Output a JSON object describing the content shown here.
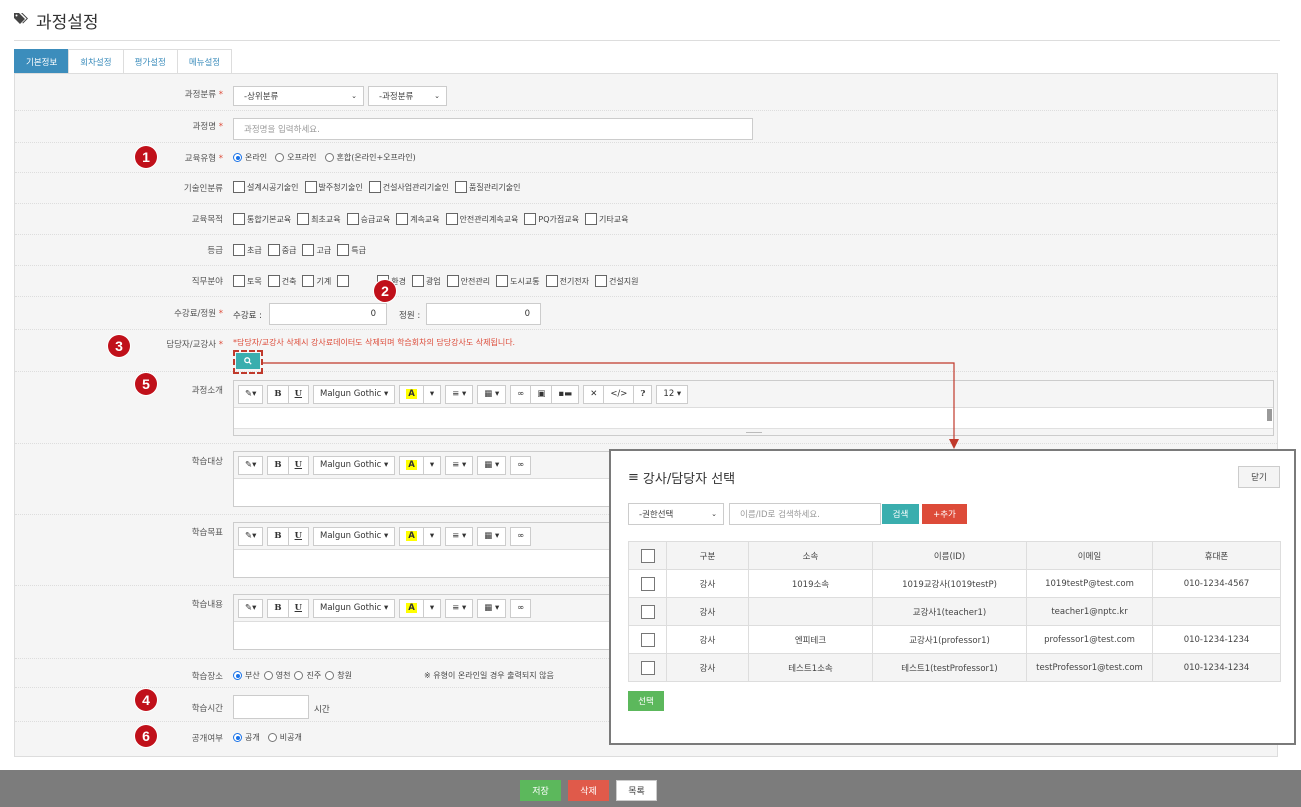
{
  "page": {
    "title": "과정설정"
  },
  "tabs": [
    {
      "label": "기본정보",
      "active": true
    },
    {
      "label": "회차설정",
      "active": false
    },
    {
      "label": "평가설정",
      "active": false
    },
    {
      "label": "메뉴설정",
      "active": false
    }
  ],
  "form": {
    "category": {
      "label": "과정분류",
      "required": "*",
      "upper_select": "-상위분류",
      "course_select": "-과정분류"
    },
    "course_name": {
      "label": "과정명",
      "required": "*",
      "placeholder": "과정명을 입력하세요."
    },
    "edu_type": {
      "label": "교육유형",
      "required": "*",
      "options": [
        "온라인",
        "오프라인",
        "혼합(온라인+오프라인)"
      ],
      "selected": "온라인"
    },
    "tech_class": {
      "label": "기술인분류",
      "options": [
        "설계시공기술인",
        "발주청기술인",
        "건설사업관리기술인",
        "품질관리기술인"
      ]
    },
    "edu_purpose": {
      "label": "교육목적",
      "options": [
        "통합기본교육",
        "최초교육",
        "승급교육",
        "계속교육",
        "안전관리계속교육",
        "PQ가점교육",
        "기타교육"
      ]
    },
    "grade": {
      "label": "등급",
      "options": [
        "초급",
        "중급",
        "고급",
        "특급"
      ]
    },
    "job_field": {
      "label": "직무분야",
      "options": [
        "토목",
        "건축",
        "기계",
        "",
        "환경",
        "광업",
        "안전관리",
        "도시교통",
        "전기전자",
        "건설지원"
      ]
    },
    "capacity": {
      "label": "수강료/정원",
      "required": "*",
      "fee_label": "수강료 :",
      "fee_value": "0",
      "cap_label": "정원 :",
      "cap_value": "0"
    },
    "instructor": {
      "label": "담당자/교강사",
      "required": "*",
      "warning": "*담당자/교강사 삭제시 강사료데이터도 삭제되며 학습회차의 담당강사도 삭제됩니다."
    },
    "intro": {
      "label": "과정소개"
    },
    "target": {
      "label": "학습대상"
    },
    "goal": {
      "label": "학습목표"
    },
    "content": {
      "label": "학습내용"
    },
    "place": {
      "label": "학습장소",
      "options": [
        "부산",
        "영천",
        "진주",
        "창원"
      ],
      "selected": "부산",
      "note": "※ 유형이 온라인일 경우 출력되지 않음"
    },
    "hours": {
      "label": "학습시간",
      "unit": "시간"
    },
    "public": {
      "label": "공개여부",
      "options": [
        "공개",
        "비공개"
      ],
      "selected": "공개"
    }
  },
  "editor_toolbar": {
    "font": "Malgun Gothic",
    "bold": "B",
    "underline": "U",
    "size": "12",
    "highlight": "A",
    "help": "?",
    "code": "</>"
  },
  "badges": [
    "1",
    "2",
    "3",
    "4",
    "5",
    "6"
  ],
  "bottom": {
    "save": "저장",
    "delete": "삭제",
    "list": "목록"
  },
  "modal": {
    "title": "강사/담당자 선택",
    "close": "닫기",
    "role_select": "-권한선택",
    "search_placeholder": "이름/ID로 검색하세요.",
    "search_btn": "검색",
    "add_btn": "+추가",
    "columns": [
      "구분",
      "소속",
      "이름(ID)",
      "이메일",
      "휴대폰"
    ],
    "rows": [
      [
        "강사",
        "1019소속",
        "1019교강사(1019testP)",
        "1019testP@test.com",
        "010-1234-4567"
      ],
      [
        "강사",
        "",
        "교강사1(teacher1)",
        "teacher1@nptc.kr",
        ""
      ],
      [
        "강사",
        "엔피테크",
        "교강사1(professor1)",
        "professor1@test.com",
        "010-1234-1234"
      ],
      [
        "강사",
        "테스트1소속",
        "테스트1(testProfessor1)",
        "testProfessor1@test.com",
        "010-1234-1234"
      ]
    ],
    "select_btn": "선택"
  },
  "colors": {
    "primary": "#3c8dbc",
    "teal": "#3aaeae",
    "danger": "#dd4b39",
    "success": "#5cb85c",
    "badge": "#c0101a"
  }
}
